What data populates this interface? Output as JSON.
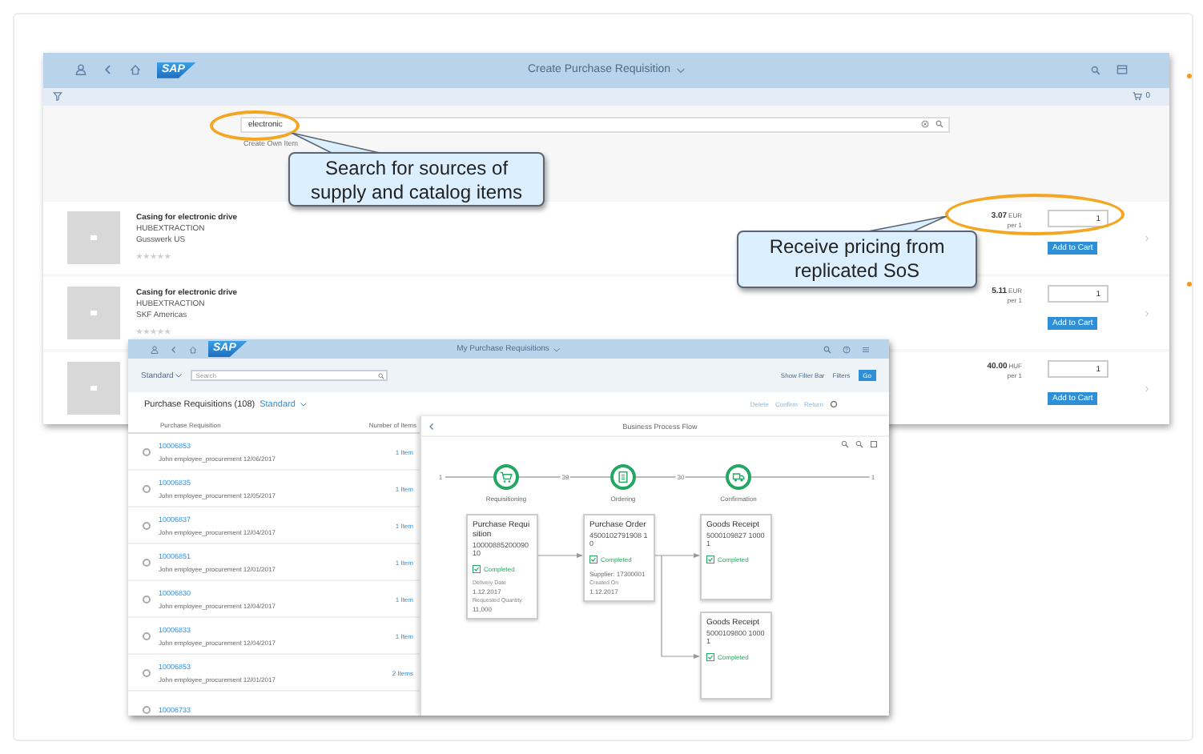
{
  "back_window": {
    "logo": "SAP",
    "title": "Create Purchase Requisition",
    "cart_count": "0",
    "search": {
      "value": "electronic"
    },
    "create_link": "Create Own Item",
    "items": [
      {
        "title": "Casing for electronic drive",
        "vendor": "HUBEXTRACTION",
        "supplier": "Gusswerk US",
        "stars": 0,
        "price": "3.07",
        "currency": "EUR",
        "unit": "per 1",
        "quantity": "1",
        "button": "Add to Cart"
      },
      {
        "title": "Casing for electronic drive",
        "vendor": "HUBEXTRACTION",
        "supplier": "SKF Americas",
        "stars": 0,
        "price": "5.11",
        "currency": "EUR",
        "unit": "per 1",
        "quantity": "1",
        "button": "Add to Cart"
      },
      {
        "price": "40.00",
        "currency": "HUF",
        "unit": "per 1",
        "quantity": "1",
        "button": "Add to Cart"
      }
    ]
  },
  "front_window": {
    "logo": "SAP",
    "title": "My Purchase Requisitions",
    "variant": "Standard",
    "search_placeholder": "Search",
    "filter_actions": [
      {
        "label": "Show Filter Bar",
        "kind": "link"
      },
      {
        "label": "Filters",
        "kind": "link"
      },
      {
        "label": "Go",
        "kind": "primary"
      }
    ],
    "table": {
      "title": "Purchase Requisitions (108)",
      "variant": "Standard",
      "actions": [
        "Delete",
        "Confirm",
        "Return"
      ],
      "columns": [
        "Purchase Requisition",
        "Number of Items"
      ],
      "rows": [
        {
          "id": "10006853",
          "subtitle": "John employee_procurement 12/06/2017",
          "items": "1 Item",
          "selected": false
        },
        {
          "id": "10006835",
          "subtitle": "John employee_procurement 12/05/2017",
          "items": "1 Item",
          "selected": false
        },
        {
          "id": "10006837",
          "subtitle": "John employee_procurement 12/04/2017",
          "items": "1 Item",
          "selected": false
        },
        {
          "id": "10006851",
          "subtitle": "John employee_procurement 12/01/2017",
          "items": "1 Item",
          "selected": false
        },
        {
          "id": "10006830",
          "subtitle": "John employee_procurement 12/04/2017",
          "items": "1 Item",
          "selected": false
        },
        {
          "id": "10006833",
          "subtitle": "John employee_procurement 12/04/2017",
          "items": "1 Item",
          "selected": false
        },
        {
          "id": "10006853",
          "subtitle": "John employee_procurement 12/01/2017",
          "items": "2 Items",
          "selected": false
        },
        {
          "id": "10006733",
          "selected": false
        }
      ]
    },
    "process_flow": {
      "title": "Business Process Flow",
      "counts": [
        "1",
        "39",
        "30",
        "1"
      ],
      "lanes": [
        {
          "label": "Requisitioning",
          "kind": "cart"
        },
        {
          "label": "Ordering",
          "kind": "document"
        },
        {
          "label": "Confirmation",
          "kind": "truck"
        }
      ],
      "nodes": [
        {
          "title": "Purchase Requisition",
          "number": "1000088520009010",
          "status": "Completed",
          "details": [
            "Delivery Date",
            "1.12.2017",
            "Requested Quantity",
            "11,000"
          ]
        },
        {
          "title": "Purchase Order",
          "number": "4500102791908 10",
          "status": "Completed",
          "details": [
            "Supplier: 17300001",
            "Created On",
            "1.12.2017"
          ]
        },
        {
          "title": "Goods Receipt",
          "number": "5000109827 1000 1",
          "status": "Completed"
        },
        {
          "title": "Goods Receipt",
          "number": "5000109800 1000 1",
          "status": "Completed"
        }
      ]
    }
  },
  "callouts": [
    {
      "text": "Search for sources of supply and catalog items"
    },
    {
      "text": "Receive pricing from replicated SoS"
    }
  ]
}
